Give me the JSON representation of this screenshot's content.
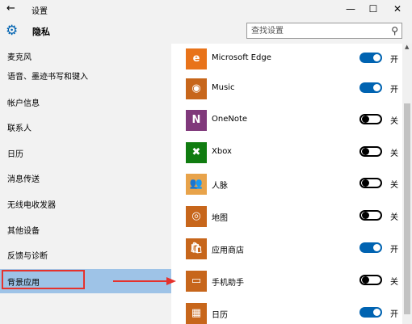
{
  "window": {
    "title": "设置",
    "back_glyph": "←",
    "minimize_glyph": "—",
    "maximize_glyph": "☐",
    "close_glyph": "✕"
  },
  "header": {
    "page_title": "隐私",
    "icon": "gear-icon",
    "search_placeholder": "查找设置",
    "search_icon": "search-icon"
  },
  "sidebar": {
    "items": [
      {
        "label": "麦克风",
        "active": false
      },
      {
        "label": "语音、墨迹书写和键入",
        "active": false
      },
      {
        "label": "帐户信息",
        "active": false
      },
      {
        "label": "联系人",
        "active": false
      },
      {
        "label": "日历",
        "active": false
      },
      {
        "label": "消息传送",
        "active": false
      },
      {
        "label": "无线电收发器",
        "active": false
      },
      {
        "label": "其他设备",
        "active": false
      },
      {
        "label": "反馈与诊断",
        "active": false
      },
      {
        "label": "背景应用",
        "active": true
      }
    ]
  },
  "apps": [
    {
      "name": "Microsoft Edge",
      "icon": "edge-icon",
      "glyph": "e",
      "color": "#e8731a",
      "on": true,
      "state": "开"
    },
    {
      "name": "Music",
      "icon": "music-icon",
      "glyph": "◉",
      "color": "#c7661b",
      "on": true,
      "state": "开"
    },
    {
      "name": "OneNote",
      "icon": "onenote-icon",
      "glyph": "N",
      "color": "#80397b",
      "on": false,
      "state": "关"
    },
    {
      "name": "Xbox",
      "icon": "xbox-icon",
      "glyph": "✖",
      "color": "#107c10",
      "on": false,
      "state": "关"
    },
    {
      "name": "人脉",
      "icon": "people-icon",
      "glyph": "👥",
      "color": "#e8a34a",
      "on": false,
      "state": "关"
    },
    {
      "name": "地图",
      "icon": "maps-icon",
      "glyph": "◎",
      "color": "#c7661b",
      "on": false,
      "state": "关"
    },
    {
      "name": "应用商店",
      "icon": "store-icon",
      "glyph": "🛍",
      "color": "#c7661b",
      "on": true,
      "state": "开"
    },
    {
      "name": "手机助手",
      "icon": "phone-companion-icon",
      "glyph": "▭",
      "color": "#c7661b",
      "on": false,
      "state": "关"
    },
    {
      "name": "日历",
      "icon": "calendar-icon",
      "glyph": "▦",
      "color": "#c7661b",
      "on": true,
      "state": "开"
    }
  ],
  "colors": {
    "accent": "#0063b1",
    "selected": "#9ec3e7",
    "annotation": "#e5322d"
  }
}
